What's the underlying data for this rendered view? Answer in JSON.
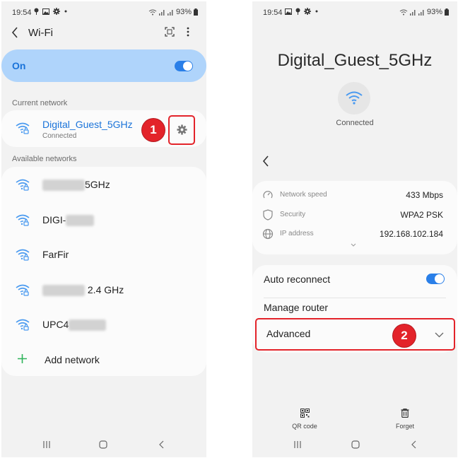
{
  "left": {
    "status": {
      "time": "19:54",
      "battery": "93%",
      "icons": [
        "location-pin-icon",
        "image-icon",
        "gear-icon",
        "dot-icon"
      ]
    },
    "header": {
      "title": "Wi-Fi",
      "back_icon": "chevron-left-icon",
      "qr_icon": "qr-scan-icon",
      "more_icon": "more-vertical-icon"
    },
    "wifi_toggle": {
      "label": "On",
      "state": true
    },
    "current_section": "Current network",
    "current_network": {
      "name": "Digital_Guest_5GHz",
      "status": "Connected",
      "settings_icon": "gear-icon"
    },
    "available_section": "Available networks",
    "networks": [
      {
        "prefix": "",
        "suffix": "5GHz",
        "redacted": "leading"
      },
      {
        "prefix": "DIGI-",
        "suffix": "",
        "redacted": "trailing"
      },
      {
        "prefix": "FarFir",
        "suffix": "",
        "redacted": "none"
      },
      {
        "prefix": "",
        "suffix": "2.4 GHz",
        "redacted": "leading"
      },
      {
        "prefix": "UPC4",
        "suffix": "",
        "redacted": "trailing"
      }
    ],
    "add_network": "Add network",
    "annotation": "1"
  },
  "right": {
    "status": {
      "time": "19:54",
      "battery": "93%",
      "icons": [
        "image-icon",
        "location-pin-icon",
        "gear-icon",
        "dot-icon"
      ]
    },
    "network_name": "Digital_Guest_5GHz",
    "connection_status": "Connected",
    "info": [
      {
        "icon": "speedometer-icon",
        "label": "Network speed",
        "value": "433 Mbps"
      },
      {
        "icon": "shield-icon",
        "label": "Security",
        "value": "WPA2 PSK"
      },
      {
        "icon": "globe-icon",
        "label": "IP address",
        "value": "192.168.102.184"
      }
    ],
    "auto_reconnect": {
      "label": "Auto reconnect",
      "state": true
    },
    "manage_router": "Manage router",
    "advanced": "Advanced",
    "annotation": "2",
    "actions": [
      {
        "icon": "qr-code-icon",
        "label": "QR code"
      },
      {
        "icon": "trash-icon",
        "label": "Forget"
      }
    ]
  },
  "colors": {
    "accent": "#1a73d9",
    "toggle": "#2a7fe8",
    "highlight": "#e3232a",
    "wifi_icon": "#4a9af0",
    "add_plus": "#2eb35a"
  }
}
